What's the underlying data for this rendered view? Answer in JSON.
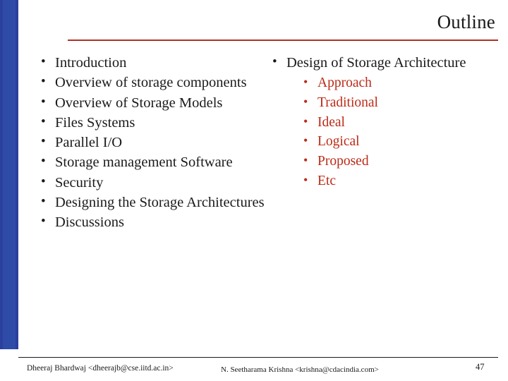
{
  "slide": {
    "title": "Outline",
    "page_number": "47",
    "accent_rule_color": "#b03024",
    "sidebar_color": "#2e4ba8",
    "sub_bullet_color": "#bb2b17"
  },
  "content": {
    "left_column": [
      {
        "label": "Introduction"
      },
      {
        "label": "Overview of storage components"
      },
      {
        "label": "Overview of Storage Models"
      },
      {
        "label": "Files Systems"
      },
      {
        "label": "Parallel I/O"
      },
      {
        "label": "Storage management Software"
      },
      {
        "label": "Security"
      },
      {
        "label": "Designing the Storage Architectures"
      },
      {
        "label": "Discussions"
      }
    ],
    "right_column": [
      {
        "label": "Design of Storage Architecture",
        "children": [
          {
            "label": "Approach"
          },
          {
            "label": "Traditional"
          },
          {
            "label": "Ideal"
          },
          {
            "label": "Logical"
          },
          {
            "label": "Proposed"
          },
          {
            "label": "Etc"
          }
        ]
      }
    ]
  },
  "footer": {
    "left": "Dheeraj Bhardwaj <dheerajb@cse.iitd.ac.in>",
    "center": "N. Seetharama Krishna <krishna@cdacindia.com>"
  },
  "bullet_glyph": "•"
}
